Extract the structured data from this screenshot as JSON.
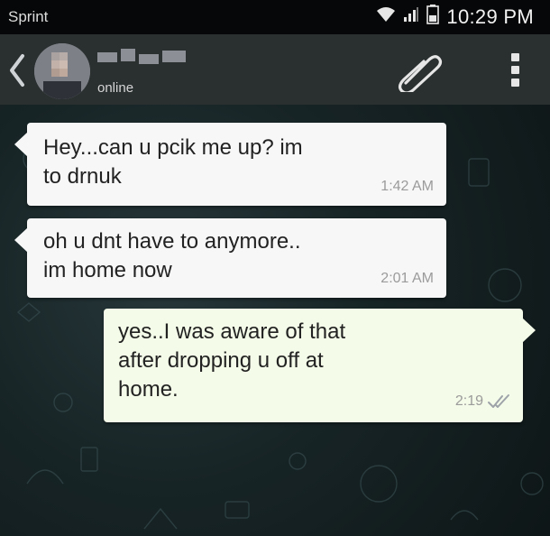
{
  "status_bar": {
    "carrier": "Sprint",
    "time": "10:29 PM",
    "icons": [
      "wifi-icon",
      "signal-icon",
      "battery-icon"
    ]
  },
  "header": {
    "contact_status": "online",
    "back_icon": "chevron-left-icon",
    "attach_icon": "paperclip-icon",
    "menu_icon": "more-vertical-icon"
  },
  "messages": [
    {
      "direction": "incoming",
      "lines": [
        "Hey...can u pcik me up? im",
        "to drnuk"
      ],
      "time": "1:42 AM"
    },
    {
      "direction": "incoming",
      "lines": [
        "oh u dnt have to anymore..",
        "im home now"
      ],
      "time": "2:01 AM"
    },
    {
      "direction": "outgoing",
      "lines": [
        "yes..I was aware of that",
        "after dropping u off at",
        "home."
      ],
      "time": "2:19",
      "read_icon": "double-check-icon"
    }
  ]
}
